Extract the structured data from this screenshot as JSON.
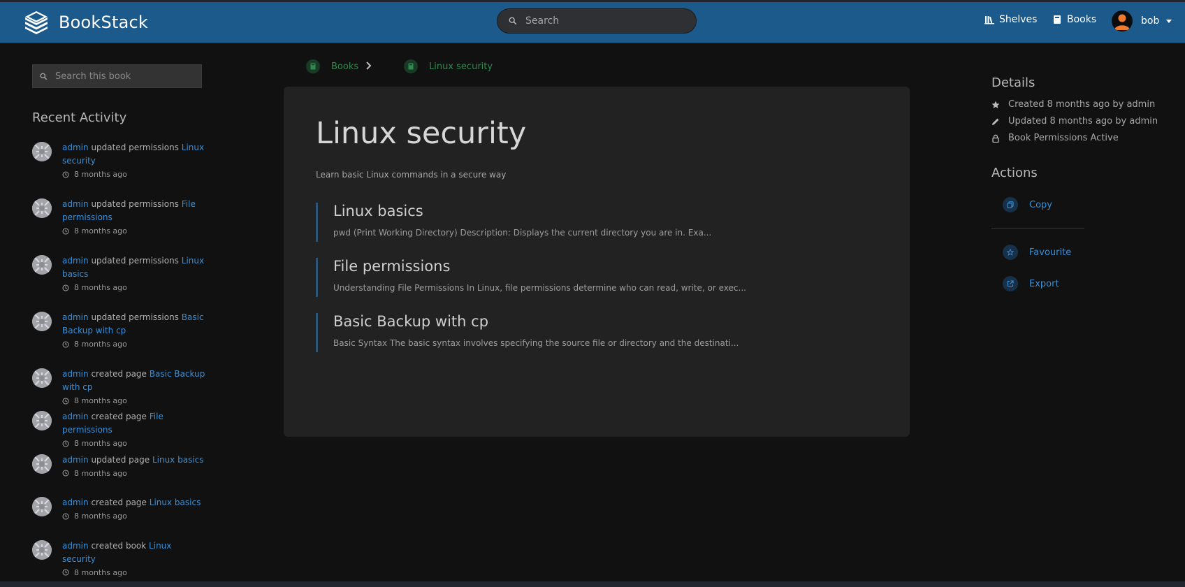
{
  "app": {
    "name": "BookStack"
  },
  "header": {
    "search_placeholder": "Search",
    "nav": [
      {
        "label": "Shelves",
        "icon": "shelves-icon"
      },
      {
        "label": "Books",
        "icon": "books-icon"
      }
    ],
    "user": {
      "name": "bob"
    }
  },
  "sidebar_left": {
    "book_search_placeholder": "Search this book",
    "recent_activity_title": "Recent Activity",
    "activities": [
      {
        "user": "admin",
        "action": "updated permissions",
        "target": "Linux security",
        "time": "8 months ago"
      },
      {
        "user": "admin",
        "action": "updated permissions",
        "target": "File permissions",
        "time": "8 months ago"
      },
      {
        "user": "admin",
        "action": "updated permissions",
        "target": "Linux basics",
        "time": "8 months ago"
      },
      {
        "user": "admin",
        "action": "updated permissions",
        "target": "Basic Backup with cp",
        "time": "8 months ago"
      },
      {
        "user": "admin",
        "action": "created page",
        "target": "Basic Backup with cp",
        "time": "8 months ago"
      },
      {
        "user": "admin",
        "action": "created page",
        "target": "File permissions",
        "time": "8 months ago"
      },
      {
        "user": "admin",
        "action": "updated page",
        "target": "Linux basics",
        "time": "8 months ago"
      },
      {
        "user": "admin",
        "action": "created page",
        "target": "Linux basics",
        "time": "8 months ago"
      },
      {
        "user": "admin",
        "action": "created book",
        "target": "Linux security",
        "time": "8 months ago"
      }
    ]
  },
  "breadcrumb": [
    {
      "label": "Books"
    },
    {
      "label": "Linux security"
    }
  ],
  "book": {
    "title": "Linux security",
    "description": "Learn basic Linux commands in a secure way",
    "pages": [
      {
        "title": "Linux basics",
        "excerpt": "pwd (Print Working Directory) Description: Displays the current directory you are in. Exa..."
      },
      {
        "title": "File permissions",
        "excerpt": "Understanding File Permissions In Linux, file permissions determine who can read, write, or exec..."
      },
      {
        "title": "Basic Backup with cp",
        "excerpt": "Basic Syntax The basic syntax involves specifying the source file or directory and the destinati..."
      }
    ]
  },
  "sidebar_right": {
    "details_title": "Details",
    "details": [
      {
        "text": "Created 8 months ago by admin",
        "icon": "star-icon"
      },
      {
        "text": "Updated 8 months ago by admin",
        "icon": "pencil-icon"
      },
      {
        "text": "Book Permissions Active",
        "icon": "lock-icon"
      }
    ],
    "actions_title": "Actions",
    "actions": [
      {
        "label": "Copy",
        "icon": "copy-icon"
      },
      {
        "label": "Favourite",
        "icon": "star-outline-icon"
      },
      {
        "label": "Export",
        "icon": "export-icon"
      }
    ]
  },
  "colors": {
    "header_bg": "#1c5a8c",
    "page_bg": "#111111",
    "card_bg": "#222222",
    "link": "#3a8fd6",
    "book_accent": "#2f8a4e",
    "chapter_border": "#2c5578"
  }
}
